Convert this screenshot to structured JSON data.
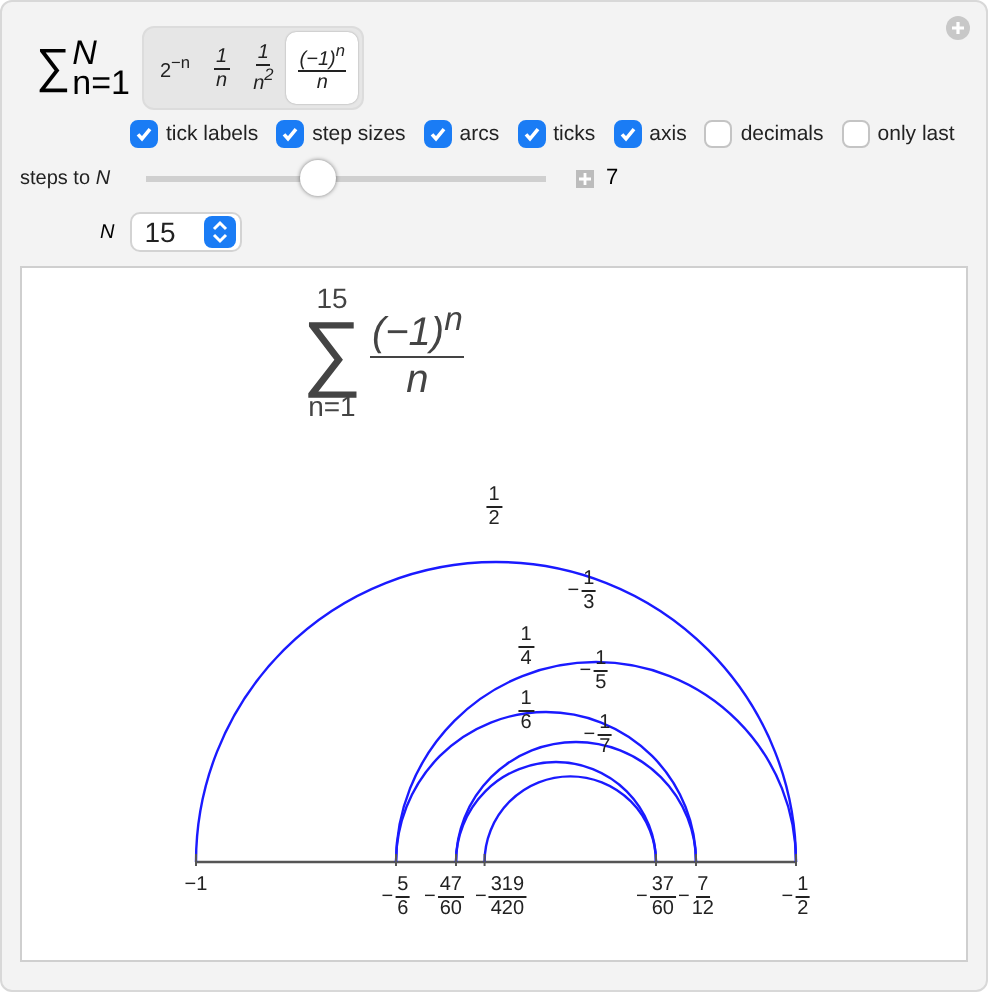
{
  "sum_label": {
    "symbol": "∑",
    "upper": "N",
    "lower": "n=1"
  },
  "series_options": [
    {
      "kind": "power",
      "text": "2$^{−n}$",
      "selected": false
    },
    {
      "kind": "fraction",
      "numerator": "1",
      "denominator": "n",
      "selected": false
    },
    {
      "kind": "fraction",
      "numerator": "1",
      "denominator": "n$^{2}$",
      "selected": false
    },
    {
      "kind": "fraction",
      "numerator": "(−1)$^{n}$",
      "denominator": "n",
      "selected": true
    }
  ],
  "checkboxes": [
    {
      "label": "tick labels",
      "checked": true
    },
    {
      "label": "step sizes",
      "checked": true
    },
    {
      "label": "arcs",
      "checked": true
    },
    {
      "label": "ticks",
      "checked": true
    },
    {
      "label": "axis",
      "checked": true
    },
    {
      "label": "decimals",
      "checked": false
    },
    {
      "label": "only last",
      "checked": false
    }
  ],
  "slider": {
    "label": "steps to N",
    "level": 0.43,
    "value": "7"
  },
  "n_select": {
    "label": "N",
    "value": "15"
  },
  "plot": {
    "title": {
      "symbol": "∑",
      "upper": "15",
      "lower": "n=1",
      "numerator": "(−1)$^{n}$",
      "denominator": "n"
    },
    "step_labels": [
      {
        "numerator": "1",
        "denominator": "2"
      },
      {
        "sign": "−",
        "numerator": "1",
        "denominator": "3"
      },
      {
        "numerator": "1",
        "denominator": "4"
      },
      {
        "sign": "−",
        "numerator": "1",
        "denominator": "5"
      },
      {
        "numerator": "1",
        "denominator": "6"
      },
      {
        "sign": "−",
        "numerator": "1",
        "denominator": "7"
      }
    ],
    "tick_labels": [
      {
        "kind": "integer",
        "text": "−1"
      },
      {
        "kind": "fraction",
        "sign": "−",
        "numerator": "5",
        "denominator": "6"
      },
      {
        "kind": "fraction",
        "sign": "−",
        "numerator": "47",
        "denominator": "60"
      },
      {
        "kind": "fraction",
        "sign": "−",
        "numerator": "319",
        "denominator": "420"
      },
      {
        "kind": "fraction",
        "sign": "−",
        "numerator": "37",
        "denominator": "60"
      },
      {
        "kind": "fraction",
        "sign": "−",
        "numerator": "7",
        "denominator": "12"
      },
      {
        "kind": "fraction",
        "sign": "−",
        "numerator": "1",
        "denominator": "2"
      }
    ]
  }
}
